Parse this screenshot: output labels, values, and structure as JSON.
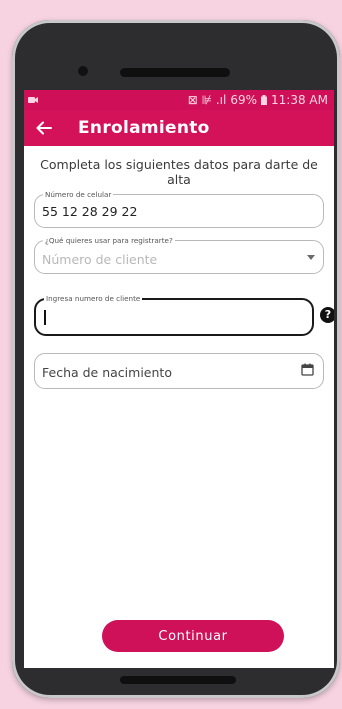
{
  "status_bar": {
    "signal_text": "⊠ ⊯ .ıl",
    "battery": "69%",
    "time": "11:38 AM"
  },
  "app_bar": {
    "title": "Enrolamiento"
  },
  "form": {
    "subtitle": "Completa los siguientes datos para darte de alta",
    "phone_field": {
      "label": "Número de celular",
      "value": "55 12 28 29 22"
    },
    "reason_field": {
      "label": "¿Qué quieres usar para registrarte?",
      "placeholder": "Número de cliente"
    },
    "client_field": {
      "label": "Ingresa numero de cliente",
      "value": ""
    },
    "birth_field": {
      "placeholder": "Fecha de nacimiento"
    }
  },
  "continue_label": "Continuar",
  "colors": {
    "brand": "#d3125a",
    "background": "#f7d3e2"
  }
}
